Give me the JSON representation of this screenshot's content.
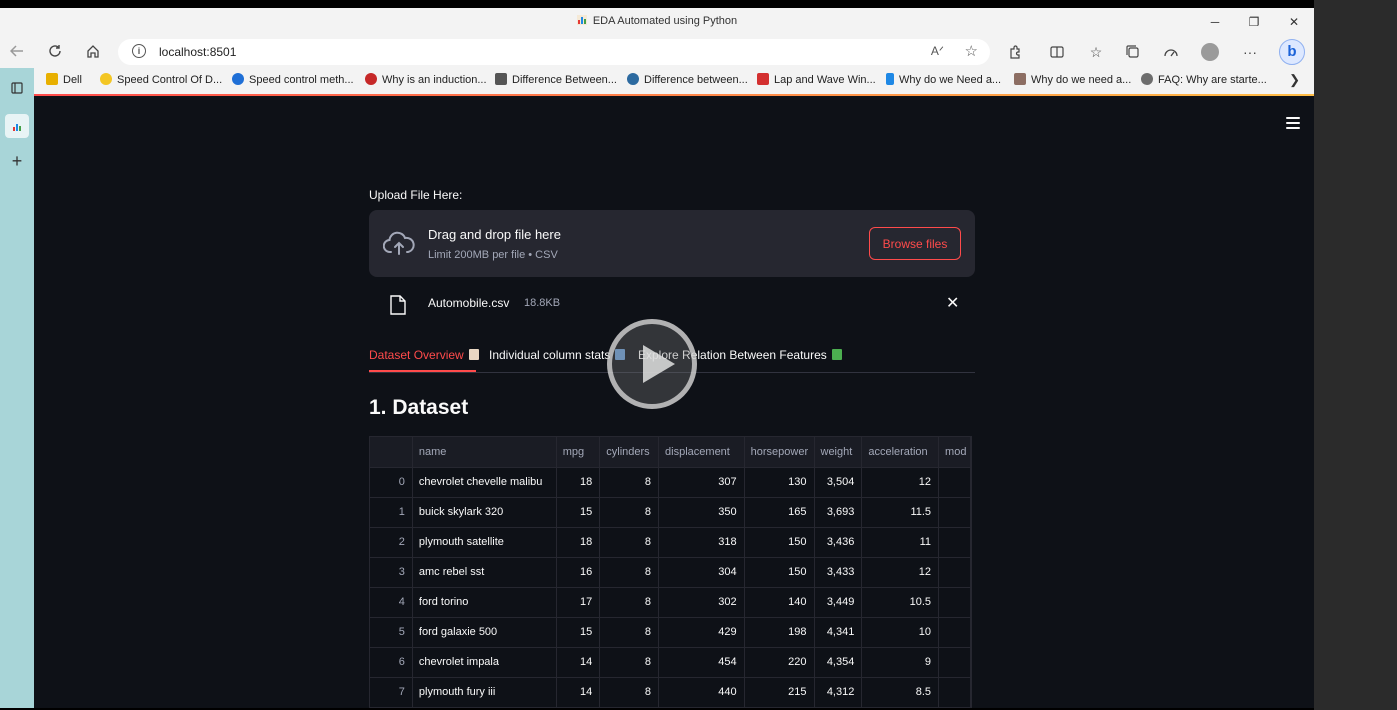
{
  "window": {
    "title": "EDA Automated using Python",
    "controls": {
      "minimize": "─",
      "restore": "❐",
      "close": "✕"
    }
  },
  "nav": {
    "url": "localhost:8501",
    "read_aloud": "Aᐟ",
    "icons": [
      "back-icon",
      "refresh-icon",
      "home-icon",
      "extensions-icon",
      "split-screen-icon",
      "favorites-icon",
      "collections-icon",
      "performance-icon",
      "profile-icon",
      "more-icon",
      "bing-icon"
    ],
    "more": "···",
    "bing": "b"
  },
  "bookmarks": [
    {
      "label": "Dell",
      "color": "#e8b000"
    },
    {
      "label": "Speed Control Of D...",
      "color": "#f3c623"
    },
    {
      "label": "Speed control meth...",
      "color": "#1f6fd6"
    },
    {
      "label": "Why is an induction...",
      "color": "#c62828"
    },
    {
      "label": "Difference Between...",
      "color": "#555555"
    },
    {
      "label": "Difference between...",
      "color": "#2c6aa0"
    },
    {
      "label": "Lap and Wave Win...",
      "color": "#d32f2f"
    },
    {
      "label": "Why do we Need a...",
      "color": "#1e88e5"
    },
    {
      "label": "Why do we need a...",
      "color": "#8d6e63"
    },
    {
      "label": "FAQ: Why are starte...",
      "color": "#6d6d6d"
    }
  ],
  "upload": {
    "label": "Upload File Here:",
    "drop_title": "Drag and drop file here",
    "drop_sub": "Limit 200MB per file • CSV",
    "browse": "Browse files",
    "file_name": "Automobile.csv",
    "file_size": "18.8KB",
    "remove": "✕"
  },
  "tabs": [
    {
      "label": "Dataset Overview",
      "active": true,
      "emoji_color": "#e9d7c3"
    },
    {
      "label": "Individual column stats",
      "active": false,
      "emoji_color": "#6a9fd8"
    },
    {
      "label": "Explore Relation Between Features",
      "active": false,
      "emoji_color": "#4caf50"
    }
  ],
  "section_title": "1. Dataset",
  "table": {
    "columns": [
      "",
      "name",
      "mpg",
      "cylinders",
      "displacement",
      "horsepower",
      "weight",
      "acceleration",
      "mod"
    ],
    "rows": [
      [
        "0",
        "chevrolet chevelle malibu",
        "18",
        "8",
        "307",
        "130",
        "3,504",
        "12",
        ""
      ],
      [
        "1",
        "buick skylark 320",
        "15",
        "8",
        "350",
        "165",
        "3,693",
        "11.5",
        ""
      ],
      [
        "2",
        "plymouth satellite",
        "18",
        "8",
        "318",
        "150",
        "3,436",
        "11",
        ""
      ],
      [
        "3",
        "amc rebel sst",
        "16",
        "8",
        "304",
        "150",
        "3,433",
        "12",
        ""
      ],
      [
        "4",
        "ford torino",
        "17",
        "8",
        "302",
        "140",
        "3,449",
        "10.5",
        ""
      ],
      [
        "5",
        "ford galaxie 500",
        "15",
        "8",
        "429",
        "198",
        "4,341",
        "10",
        ""
      ],
      [
        "6",
        "chevrolet impala",
        "14",
        "8",
        "454",
        "220",
        "4,354",
        "9",
        ""
      ],
      [
        "7",
        "plymouth fury iii",
        "14",
        "8",
        "440",
        "215",
        "4,312",
        "8.5",
        ""
      ],
      [
        "8",
        "",
        "",
        "",
        "",
        "",
        "",
        "",
        ""
      ]
    ]
  },
  "colors": {
    "accent": "#ff4b4b",
    "app_bg": "#0e1117",
    "panel_bg": "#262730"
  }
}
